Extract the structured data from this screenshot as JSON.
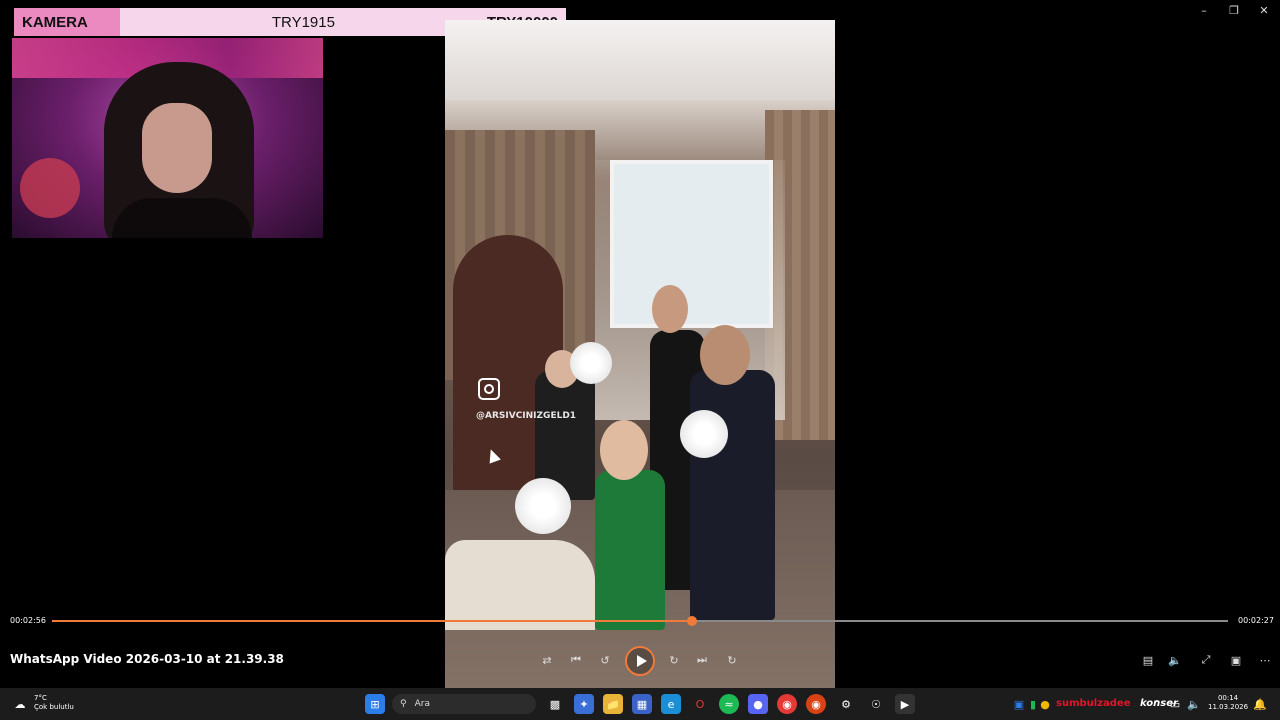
{
  "overlay": {
    "camera_label": "KAMERA",
    "amount_raised": "TRY1915",
    "goal": "TRY10000"
  },
  "video": {
    "instagram_handle": "@ARSIVCINIZGELD1"
  },
  "player": {
    "time_elapsed": "00:02:56",
    "time_total": "00:02:27",
    "progress": 0.544,
    "title": "WhatsApp Video 2026-03-10 at 21.39.38",
    "accent_color": "#f07a3a"
  },
  "taskbar": {
    "weather_temp": "7°C",
    "weather_desc": "Çok bulutlu",
    "search_placeholder": "Ara",
    "tray_red_text": "sumbulzadee",
    "tray_white_text": "konser",
    "clock_time": "00:14",
    "clock_date": "11.03.2026"
  }
}
